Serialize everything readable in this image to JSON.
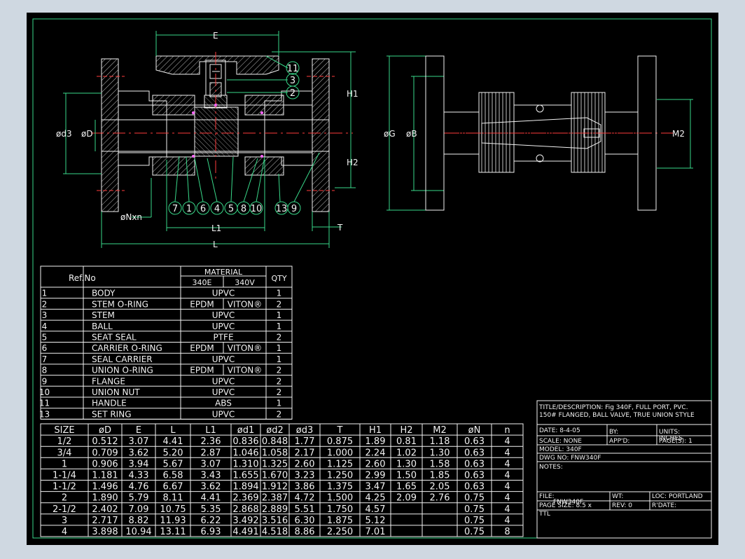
{
  "drawing": {
    "dim_labels": {
      "E": "E",
      "H1": "H1",
      "H2": "H2",
      "d3": "ød3",
      "D": "øD",
      "G": "øG",
      "B": "øB",
      "M2": "M2",
      "N": "øNxn",
      "L1": "L1",
      "L": "L",
      "T": "T"
    },
    "balloons_top": [
      "11",
      "3",
      "2"
    ],
    "balloons_bottom": [
      "7",
      "1",
      "6",
      "4",
      "5",
      "8",
      "10",
      "13",
      "9"
    ]
  },
  "parts_table": {
    "header_ref": "Ref.No",
    "header_material": "MATERIAL",
    "header_340e": "340E",
    "header_340v": "340V",
    "header_qty": "QTY",
    "rows": [
      {
        "ref": "1",
        "name": "BODY",
        "mat": "UPVC",
        "e": "",
        "v": "",
        "qty": "1"
      },
      {
        "ref": "2",
        "name": "STEM O-RING",
        "mat": "",
        "e": "EPDM",
        "v": "VITON®",
        "qty": "2"
      },
      {
        "ref": "3",
        "name": "STEM",
        "mat": "UPVC",
        "e": "",
        "v": "",
        "qty": "1"
      },
      {
        "ref": "4",
        "name": "BALL",
        "mat": "UPVC",
        "e": "",
        "v": "",
        "qty": "1"
      },
      {
        "ref": "5",
        "name": "SEAT SEAL",
        "mat": "PTFE",
        "e": "",
        "v": "",
        "qty": "2"
      },
      {
        "ref": "6",
        "name": "CARRIER O-RING",
        "mat": "",
        "e": "EPDM",
        "v": "VITON®",
        "qty": "1"
      },
      {
        "ref": "7",
        "name": "SEAL CARRIER",
        "mat": "UPVC",
        "e": "",
        "v": "",
        "qty": "1"
      },
      {
        "ref": "8",
        "name": "UNION O-RING",
        "mat": "",
        "e": "EPDM",
        "v": "VITON®",
        "qty": "2"
      },
      {
        "ref": "9",
        "name": "FLANGE",
        "mat": "UPVC",
        "e": "",
        "v": "",
        "qty": "2"
      },
      {
        "ref": "10",
        "name": "UNION NUT",
        "mat": "UPVC",
        "e": "",
        "v": "",
        "qty": "2"
      },
      {
        "ref": "11",
        "name": "HANDLE",
        "mat": "ABS",
        "e": "",
        "v": "",
        "qty": "1"
      },
      {
        "ref": "13",
        "name": "SET RING",
        "mat": "UPVC",
        "e": "",
        "v": "",
        "qty": "2"
      }
    ]
  },
  "size_table": {
    "headers": [
      "SIZE",
      "øD",
      "E",
      "L",
      "L1",
      "ød1",
      "ød2",
      "ød3",
      "T",
      "H1",
      "H2",
      "M2",
      "øN",
      "n"
    ],
    "rows": [
      [
        "1/2",
        "0.512",
        "3.07",
        "4.41",
        "2.36",
        "0.836",
        "0.848",
        "1.77",
        "0.875",
        "1.89",
        "0.81",
        "1.18",
        "0.63",
        "4"
      ],
      [
        "3/4",
        "0.709",
        "3.62",
        "5.20",
        "2.87",
        "1.046",
        "1.058",
        "2.17",
        "1.000",
        "2.24",
        "1.02",
        "1.30",
        "0.63",
        "4"
      ],
      [
        "1",
        "0.906",
        "3.94",
        "5.67",
        "3.07",
        "1.310",
        "1.325",
        "2.60",
        "1.125",
        "2.60",
        "1.30",
        "1.58",
        "0.63",
        "4"
      ],
      [
        "1-1/4",
        "1.181",
        "4.33",
        "6.58",
        "3.43",
        "1.655",
        "1.670",
        "3.23",
        "1.250",
        "2.99",
        "1.50",
        "1.85",
        "0.63",
        "4"
      ],
      [
        "1-1/2",
        "1.496",
        "4.76",
        "6.67",
        "3.62",
        "1.894",
        "1.912",
        "3.86",
        "1.375",
        "3.47",
        "1.65",
        "2.05",
        "0.63",
        "4"
      ],
      [
        "2",
        "1.890",
        "5.79",
        "8.11",
        "4.41",
        "2.369",
        "2.387",
        "4.72",
        "1.500",
        "4.25",
        "2.09",
        "2.76",
        "0.75",
        "4"
      ],
      [
        "2-1/2",
        "2.402",
        "7.09",
        "10.75",
        "5.35",
        "2.868",
        "2.889",
        "5.51",
        "1.750",
        "4.57",
        "",
        "",
        "0.75",
        "4"
      ],
      [
        "3",
        "2.717",
        "8.82",
        "11.93",
        "6.22",
        "3.492",
        "3.516",
        "6.30",
        "1.875",
        "5.12",
        "",
        "",
        "0.75",
        "4"
      ],
      [
        "4",
        "3.898",
        "10.94",
        "13.11",
        "6.93",
        "4.491",
        "4.518",
        "8.86",
        "2.250",
        "7.01",
        "",
        "",
        "0.75",
        "8"
      ]
    ]
  },
  "title_block": {
    "title_desc_1": "TITLE/DESCRIPTION: Fig 340F, FULL PORT, PVC.",
    "title_desc_2": "150# FLANGED, BALL VALVE, TRUE UNION STYLE",
    "date": "DATE:  8-4-05",
    "by": "BY:",
    "units": "UNITS:",
    "units_val": "INCHES",
    "scale": "SCALE:  NONE",
    "appd": "APP'D:",
    "pages": "PAGE(S):  1",
    "model": "MODEL:   340F",
    "dwg_no": "DWG NO:  FNW340F",
    "notes": "NOTES:",
    "file": "FILE:",
    "wt": "WT:",
    "loc": "LOC:  PORTLAND",
    "file_val": "FNW340F",
    "page_size": "PAGE SIZE: 8.5 x",
    "rev": "REV:  0",
    "rdate": "R'DATE:",
    "ttl": "TTL"
  }
}
